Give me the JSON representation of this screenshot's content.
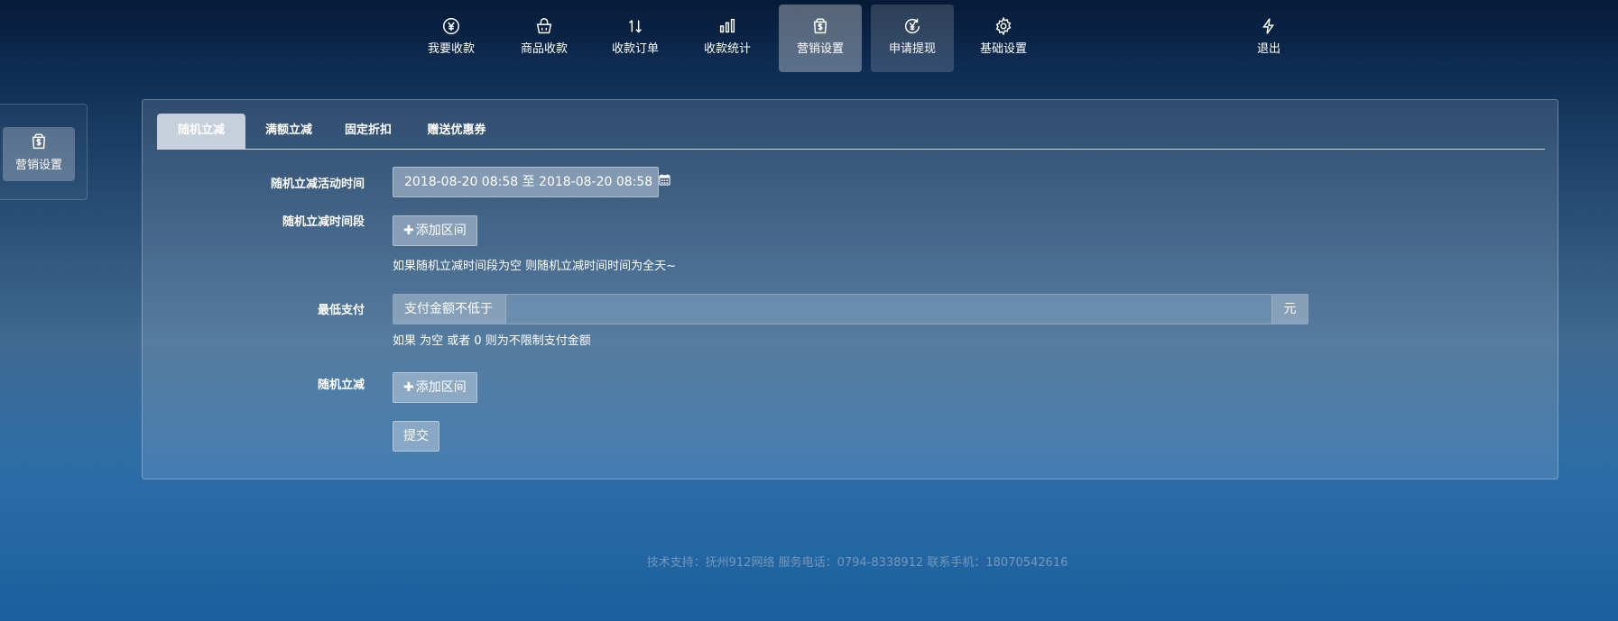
{
  "nav": {
    "items": [
      {
        "label": "我要收款",
        "icon": "yen-circle-icon"
      },
      {
        "label": "商品收款",
        "icon": "shopping-basket-icon"
      },
      {
        "label": "收款订单",
        "icon": "sort-arrows-icon"
      },
      {
        "label": "收款统计",
        "icon": "bar-chart-icon"
      },
      {
        "label": "营销设置",
        "icon": "dollar-bag-icon"
      },
      {
        "label": "申请提现",
        "icon": "yen-refresh-icon"
      },
      {
        "label": "基础设置",
        "icon": "gear-icon"
      },
      {
        "label": "退出",
        "icon": "lightning-icon"
      }
    ],
    "active_item": "营销设置"
  },
  "sidebar": {
    "items": [
      {
        "label": "营销设置",
        "icon": "dollar-bag-icon"
      }
    ]
  },
  "tabs": [
    {
      "label": "随机立减"
    },
    {
      "label": "满额立减"
    },
    {
      "label": "固定折扣"
    },
    {
      "label": "赠送优惠券"
    }
  ],
  "active_tab": "随机立减",
  "form": {
    "activity_time_label": "随机立减活动时间",
    "activity_time_value": "2018-08-20 08:58 至 2018-08-20 08:58",
    "time_slot_label": "随机立减时间段",
    "add_range_label": "添加区间",
    "time_slot_hint": "如果随机立减时间段为空 则随机立减时间时间为全天~",
    "min_pay_label": "最低支付",
    "min_pay_prefix": "支付金额不低于",
    "min_pay_value": "",
    "min_pay_unit": "元",
    "min_pay_hint": "如果 为空 或者 0 则为不限制支付金额",
    "random_discount_label": "随机立减",
    "submit_label": "提交"
  },
  "footer": {
    "text": "技术支持：抚州912网络 服务电话：0794-8338912  联系手机：18070542616"
  },
  "colors": {
    "background_top": "#061a36",
    "background_bottom": "#1b5f9e",
    "footer_text": "#82a0be"
  }
}
